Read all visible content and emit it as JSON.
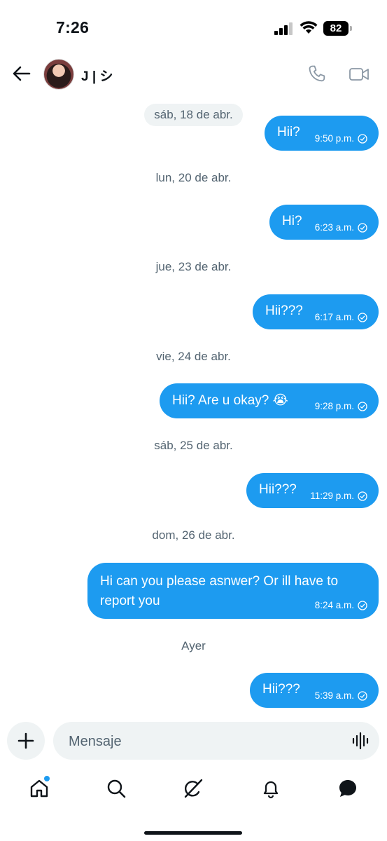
{
  "status_bar": {
    "time": "7:26",
    "battery": "82"
  },
  "header": {
    "contact_name": "J | シ"
  },
  "conversation": [
    {
      "type": "date",
      "label": "sáb, 18 de abr."
    },
    {
      "type": "message",
      "text": "Hii?",
      "time": "9:50 p.m."
    },
    {
      "type": "date",
      "label": "lun, 20 de abr."
    },
    {
      "type": "message",
      "text": "Hi?",
      "time": "6:23 a.m."
    },
    {
      "type": "date",
      "label": "jue, 23 de abr."
    },
    {
      "type": "message",
      "text": "Hii???",
      "time": "6:17 a.m."
    },
    {
      "type": "date",
      "label": "vie, 24 de abr."
    },
    {
      "type": "message",
      "text": "Hii? Are u okay? 😭",
      "time": "9:28 p.m."
    },
    {
      "type": "date",
      "label": "sáb, 25 de abr."
    },
    {
      "type": "message",
      "text": "Hii???",
      "time": "11:29 p.m."
    },
    {
      "type": "date",
      "label": "dom, 26 de abr."
    },
    {
      "type": "message",
      "text": "Hi can you please asnwer? Or ill have to report you",
      "time": "8:24 a.m."
    },
    {
      "type": "date",
      "label": "Ayer"
    },
    {
      "type": "message",
      "text": "Hii???",
      "time": "5:39 a.m."
    }
  ],
  "composer": {
    "placeholder": "Mensaje"
  },
  "colors": {
    "accent": "#1d9bf0",
    "muted": "#536471",
    "surface": "#eff3f4"
  },
  "bottom_nav": [
    {
      "icon": "home-icon",
      "has_dot": true
    },
    {
      "icon": "search-icon"
    },
    {
      "icon": "grok-icon"
    },
    {
      "icon": "bell-icon"
    },
    {
      "icon": "messages-icon"
    }
  ]
}
